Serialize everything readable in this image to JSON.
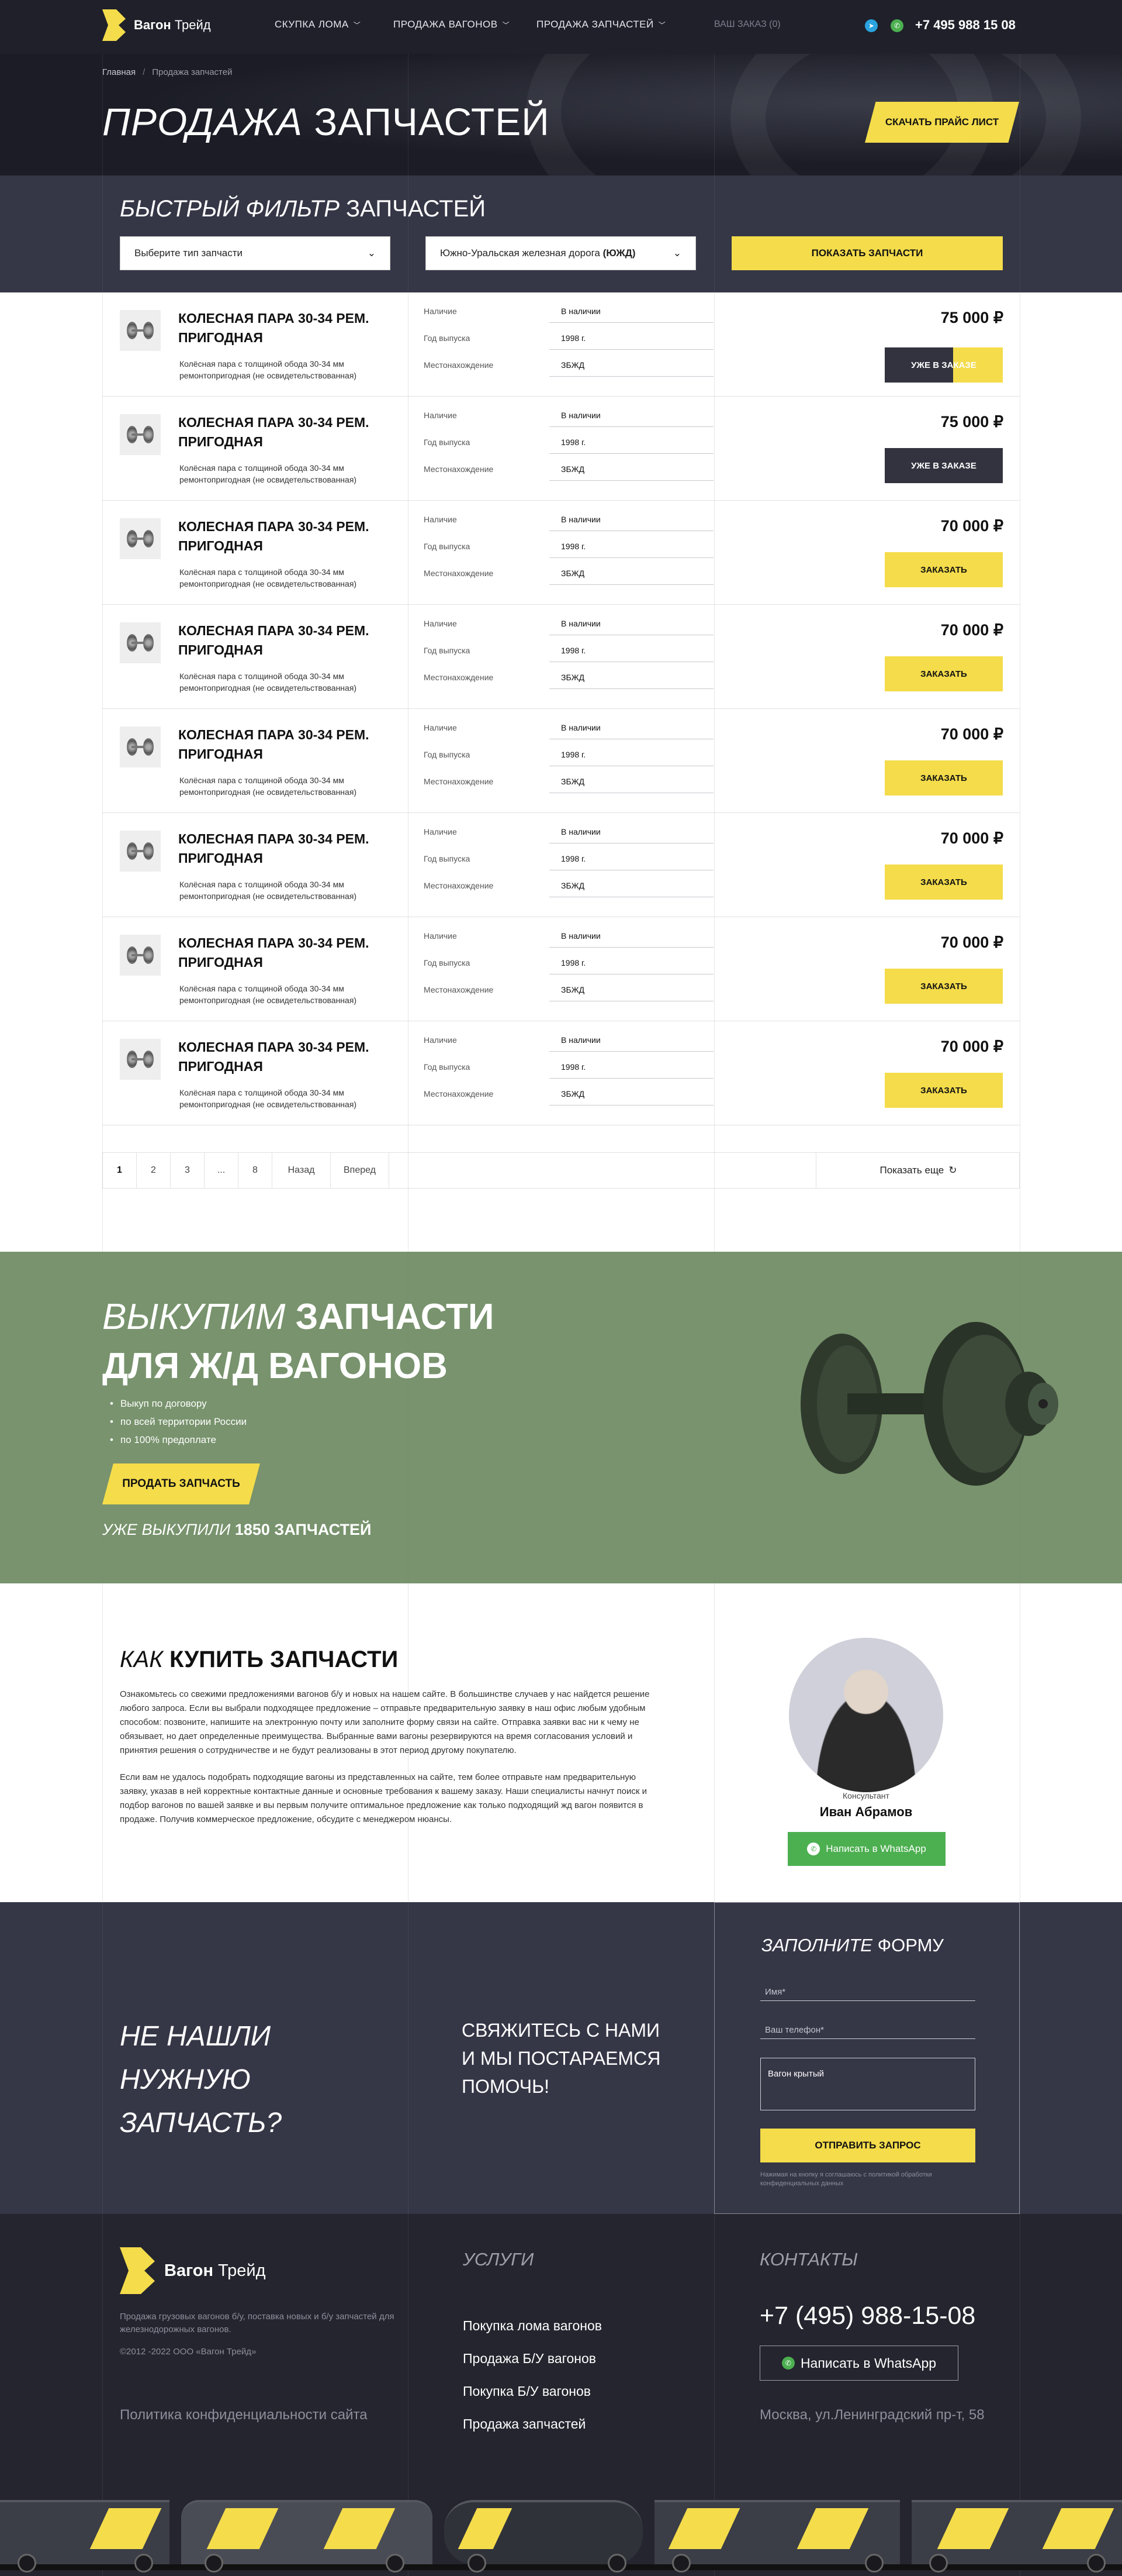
{
  "header": {
    "logo_bold": "Вагон",
    "logo_light": " Трейд",
    "nav": [
      "СКУПКА ЛОМА",
      "ПРОДАЖА ВАГОНОВ",
      "ПРОДАЖА ЗАПЧАСТЕЙ"
    ],
    "order": "ВАШ ЗАКАЗ (0)",
    "phone": "+7 495 988 15 08",
    "accent": "#f4dc4b"
  },
  "breadcrumb": {
    "home": "Главная",
    "sep": "/",
    "current": "Продажа запчастей"
  },
  "hero": {
    "title_light": "ПРОДАЖА",
    "title_bold": "ЗАПЧАСТЕЙ",
    "price_button": "СКАЧАТЬ ПРАЙС ЛИСТ"
  },
  "filter": {
    "title_light": "БЫСТРЫЙ ФИЛЬТР",
    "title_bold": "ЗАПЧАСТЕЙ",
    "type_select": "Выберите тип запчасти",
    "road_select": "Южно-Уральская железная дорога",
    "road_abbr": "(ЮЖД)",
    "show_button": "ПОКАЗАТЬ ЗАПЧАСТИ"
  },
  "spec_labels": {
    "avail": "Наличие",
    "year": "Год выпуска",
    "loc": "Местонахождение"
  },
  "products": [
    {
      "name": "КОЛЕСНАЯ ПАРА 30-34 РЕМ. ПРИГОДНАЯ",
      "desc": "Колёсная пара с толщиной обода 30-34 мм ремонтопригодная (не освидетельствованная)",
      "avail": "В наличии",
      "year": "1998 г.",
      "loc": "ЗБЖД",
      "price": "75 000 ₽",
      "button": "УЖЕ В ЗАКАЗЕ",
      "state": "hover"
    },
    {
      "name": "КОЛЕСНАЯ ПАРА 30-34 РЕМ. ПРИГОДНАЯ",
      "desc": "Колёсная пара с толщиной обода 30-34 мм ремонтопригодная (не освидетельствованная)",
      "avail": "В наличии",
      "year": "1998 г.",
      "loc": "ЗБЖД",
      "price": "75 000 ₽",
      "button": "УЖЕ В ЗАКАЗЕ",
      "state": "ordered"
    },
    {
      "name": "КОЛЕСНАЯ ПАРА 30-34 РЕМ. ПРИГОДНАЯ",
      "desc": "Колёсная пара с толщиной обода 30-34 мм ремонтопригодная (не освидетельствованная)",
      "avail": "В наличии",
      "year": "1998 г.",
      "loc": "ЗБЖД",
      "price": "70 000 ₽",
      "button": "ЗАКАЗАТЬ",
      "state": "order"
    },
    {
      "name": "КОЛЕСНАЯ ПАРА 30-34 РЕМ. ПРИГОДНАЯ",
      "desc": "Колёсная пара с толщиной обода 30-34 мм ремонтопригодная (не освидетельствованная)",
      "avail": "В наличии",
      "year": "1998 г.",
      "loc": "ЗБЖД",
      "price": "70 000 ₽",
      "button": "ЗАКАЗАТЬ",
      "state": "order"
    },
    {
      "name": "КОЛЕСНАЯ ПАРА 30-34 РЕМ. ПРИГОДНАЯ",
      "desc": "Колёсная пара с толщиной обода 30-34 мм ремонтопригодная (не освидетельствованная)",
      "avail": "В наличии",
      "year": "1998 г.",
      "loc": "ЗБЖД",
      "price": "70 000 ₽",
      "button": "ЗАКАЗАТЬ",
      "state": "order"
    },
    {
      "name": "КОЛЕСНАЯ ПАРА 30-34 РЕМ. ПРИГОДНАЯ",
      "desc": "Колёсная пара с толщиной обода 30-34 мм ремонтопригодная (не освидетельствованная)",
      "avail": "В наличии",
      "year": "1998 г.",
      "loc": "ЗБЖД",
      "price": "70 000 ₽",
      "button": "ЗАКАЗАТЬ",
      "state": "order"
    },
    {
      "name": "КОЛЕСНАЯ ПАРА 30-34 РЕМ. ПРИГОДНАЯ",
      "desc": "Колёсная пара с толщиной обода 30-34 мм ремонтопригодная (не освидетельствованная)",
      "avail": "В наличии",
      "year": "1998 г.",
      "loc": "ЗБЖД",
      "price": "70 000 ₽",
      "button": "ЗАКАЗАТЬ",
      "state": "order"
    },
    {
      "name": "КОЛЕСНАЯ ПАРА 30-34 РЕМ. ПРИГОДНАЯ",
      "desc": "Колёсная пара с толщиной обода 30-34 мм ремонтопригодная (не освидетельствованная)",
      "avail": "В наличии",
      "year": "1998 г.",
      "loc": "ЗБЖД",
      "price": "70 000 ₽",
      "button": "ЗАКАЗАТЬ",
      "state": "order"
    }
  ],
  "pagination": {
    "pages": [
      "1",
      "2",
      "3",
      "...",
      "8"
    ],
    "current": "1",
    "prev": "Назад",
    "next": "Вперед",
    "more": "Показать еще"
  },
  "buyout": {
    "title_light": "ВЫКУПИМ",
    "title_bold": "ЗАПЧАСТИ",
    "title_line2": "ДЛЯ Ж/Д ВАГОНОВ",
    "bullets": [
      "Выкуп по договору",
      "по всей территории России",
      "по 100% предоплате"
    ],
    "button": "ПРОДАТЬ ЗАПЧАСТЬ",
    "count_light": "УЖЕ ВЫКУПИЛИ",
    "count_bold": "1850 ЗАПЧАСТЕЙ",
    "bg": "#78936d"
  },
  "how": {
    "title_light": "КАК",
    "title_bold": "КУПИТЬ ЗАПЧАСТИ",
    "p1": "Ознакомьтесь со свежими предложениями вагонов б/у и новых на нашем сайте. В большинстве случаев у нас найдется решение любого запроса. Если вы выбрали подходящее предложение – отправьте предварительную заявку в наш офис любым удобным способом: позвоните, напишите на электронную почту или заполните форму связи на сайте. Отправка заявки вас ни к чему не обязывает, но дает определенные преимущества. Выбранные вами вагоны резервируются на время согласования условий и принятия решения о сотрудничестве и не будут реализованы в этот период другому покупателю.",
    "p2": "Если вам не удалось подобрать подходящие вагоны из представленных на сайте, тем более отправьте нам предварительную заявку, указав в ней корректные контактные данные и основные требования к вашему заказу. Наши специалисты начнут поиск и подбор вагонов по вашей заявке и вы первым получите оптимальное предложение как только подходящий жд вагон появится в продаже. Получив коммерческое предложение, обсудите с менеджером нюансы.",
    "consultant_label": "Консультант",
    "consultant_name": "Иван Абрамов",
    "whatsapp": "Написать в WhatsApp"
  },
  "cta": {
    "left": "НЕ НАШЛИ НУЖНУЮ ЗАПЧАСТЬ?",
    "middle": "СВЯЖИТЕСЬ С НАМИ И МЫ ПОСТАРАЕМСЯ ПОМОЧЬ!",
    "form_title_light": "ЗАПОЛНИТЕ",
    "form_title_bold": "ФОРМУ",
    "name_ph": "Имя*",
    "phone_ph": "Ваш телефон*",
    "message": "Вагон крытый",
    "submit": "ОТПРАВИТЬ ЗАПРОС",
    "note": "Нажимая на кнопку я соглашаюсь с политикой обработки конфиденциальных данных"
  },
  "footer": {
    "logo_bold": "Вагон",
    "logo_light": " Трейд",
    "desc": "Продажа грузовых вагонов б/у, поставка новых и б/у запчастей для железнодорожных вагонов.",
    "copy": "©2012 -2022 ООО «Вагон Трейд»",
    "policy": "Политика конфиденциальности сайта",
    "services_title": "УСЛУГИ",
    "services": [
      "Покупка лома вагонов",
      "Продажа Б/У вагонов",
      "Покупка Б/У вагонов",
      "Продажа запчастей"
    ],
    "contacts_title": "КОНТАКТЫ",
    "phone": "+7 (495) 988-15-08",
    "whatsapp": "Написать в WhatsApp",
    "address": "Москва, ул.Ленинградский пр-т, 58"
  },
  "icons": {
    "logo": "logo-mark-icon",
    "telegram": "telegram-icon",
    "whatsapp": "whatsapp-icon",
    "chevron": "chevron-down-icon",
    "reload": "reload-icon"
  }
}
